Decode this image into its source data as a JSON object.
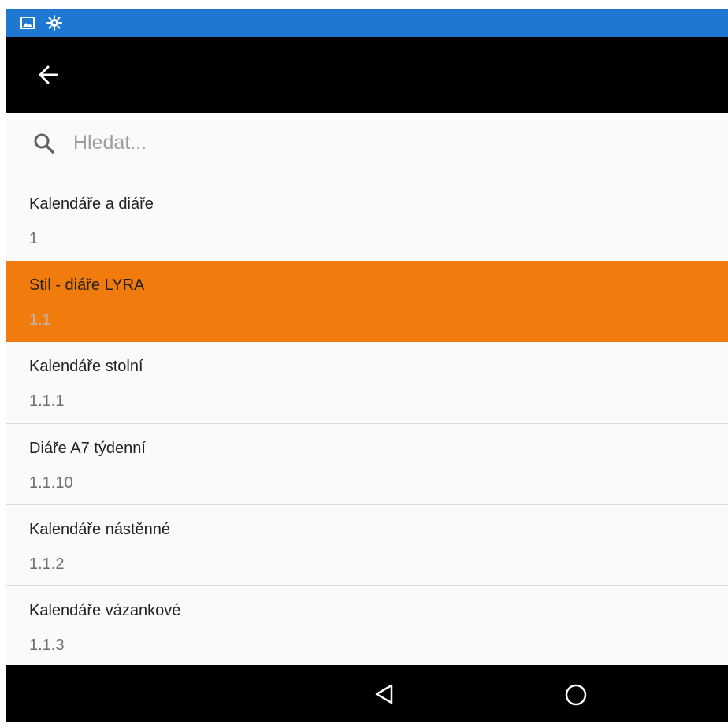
{
  "status_bar": {
    "color": "#1e78d2",
    "icons": [
      "image-icon",
      "app-notification-icon"
    ]
  },
  "toolbar": {
    "back_icon": "arrow-left-icon"
  },
  "search": {
    "placeholder": "Hledat...",
    "value": "",
    "icon": "search-icon"
  },
  "list": {
    "selected_color": "#f27b0e",
    "items": [
      {
        "title": "Kalendáře a diáře",
        "code": "1",
        "selected": false
      },
      {
        "title": "Stil - diáře LYRA",
        "code": "1.1",
        "selected": true
      },
      {
        "title": "Kalendáře stolní",
        "code": "1.1.1",
        "selected": false
      },
      {
        "title": "Diáře A7 týdenní",
        "code": "1.1.10",
        "selected": false
      },
      {
        "title": "Kalendáře nástěnné",
        "code": "1.1.2",
        "selected": false
      },
      {
        "title": "Kalendáře vázankové",
        "code": "1.1.3",
        "selected": false
      }
    ]
  },
  "nav_bar": {
    "icons": [
      "nav-back-icon",
      "nav-home-icon"
    ]
  }
}
